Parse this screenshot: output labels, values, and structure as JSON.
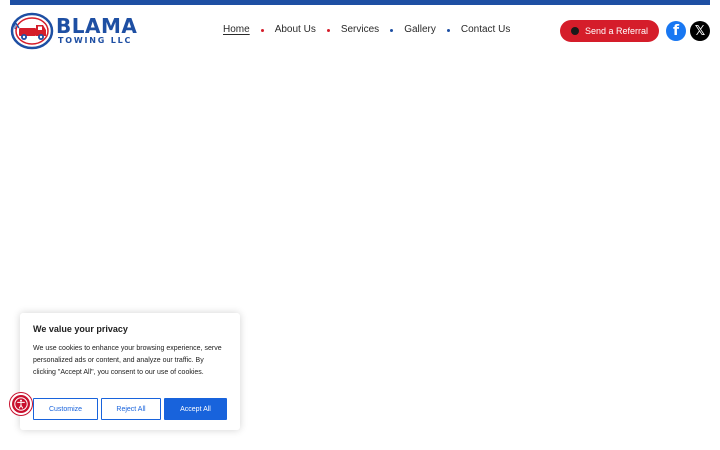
{
  "logo": {
    "wordmark": "BLAMA",
    "subtitle": "TOWING LLC"
  },
  "nav": {
    "items": [
      {
        "label": "Home",
        "active": true
      },
      {
        "label": "About Us",
        "active": false
      },
      {
        "label": "Services",
        "active": false
      },
      {
        "label": "Gallery",
        "active": false
      },
      {
        "label": "Contact Us",
        "active": false
      }
    ],
    "separator_colors": [
      "#d51d2a",
      "#d51d2a",
      "#1e4fa3",
      "#1e4fa3"
    ]
  },
  "header": {
    "referral_label": "Send a Referral",
    "facebook_glyph": "f",
    "x_glyph": "𝕏"
  },
  "cookie_banner": {
    "title": "We value your privacy",
    "body": "We use cookies to enhance your browsing experience, serve personalized ads or content, and analyze our traffic. By clicking \"Accept All\", you consent to our use of cookies.",
    "customize_label": "Customize",
    "reject_label": "Reject All",
    "accept_label": "Accept All"
  },
  "icons": {
    "logo": "tow-truck-badge-icon",
    "referral": "dot-icon",
    "facebook": "facebook-icon",
    "x": "x-twitter-icon",
    "accessibility": "accessibility-icon"
  },
  "colors": {
    "brand_blue": "#1e4fa3",
    "brand_red": "#d51d2a",
    "cookie_accent": "#1863dc",
    "facebook": "#1877f2"
  }
}
